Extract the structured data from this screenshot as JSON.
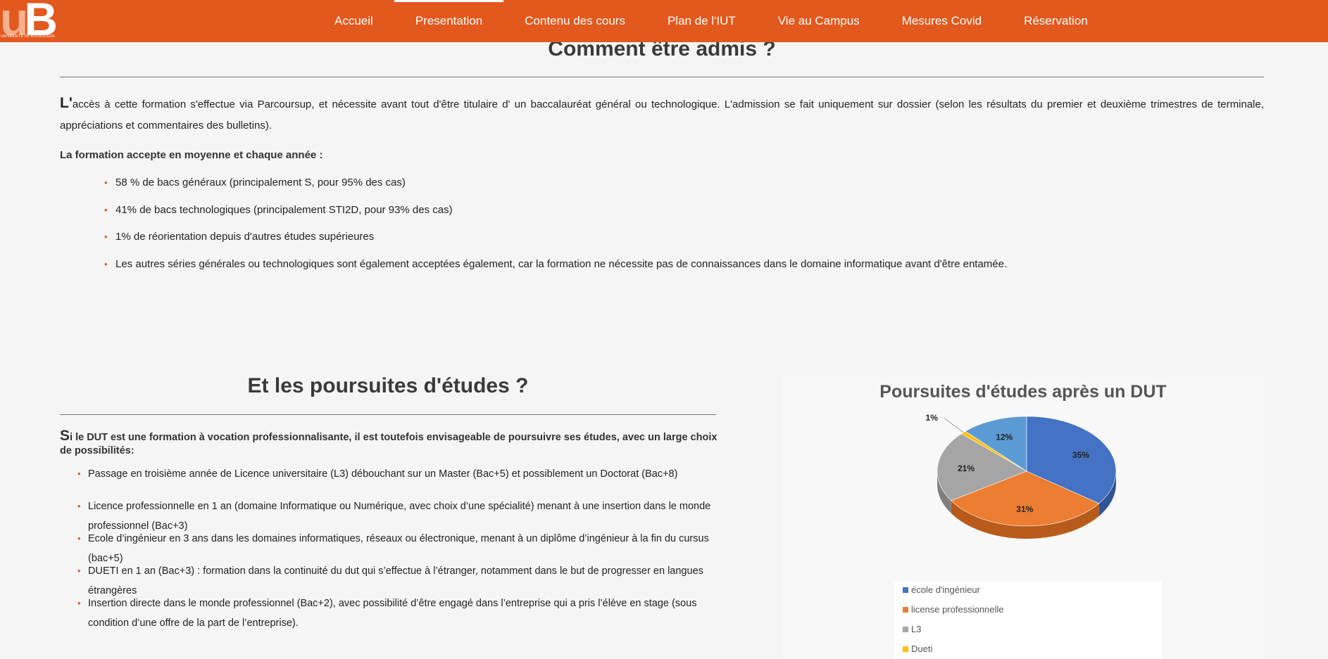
{
  "nav": {
    "logo_letters": "uB",
    "logo_subtitle": "UNIVERSITÉ DE BOURGOGNE",
    "items": [
      {
        "label": "Accueil"
      },
      {
        "label": "Presentation"
      },
      {
        "label": "Contenu des cours"
      },
      {
        "label": "Plan de l'IUT"
      },
      {
        "label": "Vie au Campus"
      },
      {
        "label": "Mesures Covid"
      },
      {
        "label": "Réservation"
      }
    ],
    "active": "Presentation",
    "accent_color": "#e2581d"
  },
  "admission": {
    "title": "Comment être admis ?",
    "dropcap": "L'",
    "paragraph": "accès à cette formation s'effectue via Parcoursup, et nécessite avant tout d'être titulaire d' un baccalauréat général ou technologique. L'admission se fait uniquement sur dossier (selon les résultats du premier et deuxième trimestres de terminale, appréciations et commentaires des bulletins).",
    "accept_title": "La formation accepte en moyenne et chaque année :",
    "items": [
      "58 % de bacs généraux (principalement S, pour 95% des cas)",
      "41% de bacs technologiques (principalement STI2D, pour 93% des cas)",
      "1% de réorientation depuis d'autres études supérieures",
      "Les autres séries générales ou technologiques sont également acceptées également, car la formation ne nécessite pas de connaissances dans le domaine informatique avant d'être entamée."
    ]
  },
  "poursuites": {
    "title": "Et les poursuites d'études ?",
    "dropcap": "S",
    "paragraph": "i le DUT est une formation à vocation professionnalisante, il est toutefois envisageable de poursuivre ses études, avec un large choix de possibilités:",
    "items": [
      "Passage en troisième année de Licence universitaire (L3) débouchant sur un Master (Bac+5) et possiblement un Doctorat (Bac+8)",
      "Licence professionnelle en 1 an (domaine Informatique ou Numérique, avec choix d’une spécialité) menant à une insertion dans le monde professionnel (Bac+3)",
      "Ecole d’ingénieur en 3 ans dans les domaines informatiques, réseaux ou électronique, menant à un diplôme d’ingénieur à la fin du cursus (bac+5)",
      "DUETI en 1 an (Bac+3) : formation dans la continuité du dut qui s’effectue à l’étranger, notamment dans le but de progresser en langues étrangères",
      "Insertion directe dans le monde professionnel (Bac+2), avec possibilité d’être engagé dans l’entreprise qui a pris l’élève en stage (sous condition d’une offre de la part de l’entreprise)."
    ]
  },
  "chart_data": {
    "type": "pie",
    "title": "Poursuites d'études après un DUT",
    "categories": [
      "école d'ingénieur",
      "license professionnelle",
      "L3",
      "Dueti",
      ""
    ],
    "values": [
      35,
      31,
      21,
      1,
      12
    ],
    "labels": [
      "35%",
      "31%",
      "21%",
      "1%",
      "12%"
    ],
    "colors": [
      "#4472c4",
      "#ed7d31",
      "#a5a5a5",
      "#ffc000",
      "#5b9bd5"
    ],
    "legend_position": "bottom",
    "style": "3d"
  }
}
